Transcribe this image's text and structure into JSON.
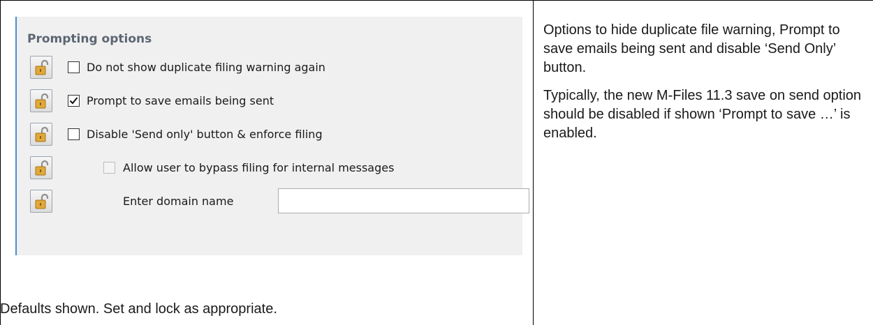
{
  "panel": {
    "title": "Prompting options",
    "rows": [
      {
        "label": "Do not show duplicate filing warning again",
        "checked": false,
        "enabled": true
      },
      {
        "label": "Prompt to save emails being sent",
        "checked": true,
        "enabled": true
      },
      {
        "label": "Disable 'Send only' button & enforce filing",
        "checked": false,
        "enabled": true
      },
      {
        "label": "Allow user to bypass filing for internal messages",
        "checked": false,
        "enabled": false
      },
      {
        "label": "Enter domain name",
        "value": ""
      }
    ]
  },
  "footer_note": "Defaults shown. Set and lock as appropriate.",
  "description": {
    "paragraph_1": "Options to hide duplicate file warning, Prompt to save emails being sent and disable ‘Send Only’ button.",
    "paragraph_2": "Typically, the new M-Files 11.3 save on send option should be disabled if shown ‘Prompt to save …’ is enabled."
  },
  "icons": {
    "lock": "padlock-unlocked-icon"
  },
  "colors": {
    "accent": "#4f8bd3",
    "panel_bg": "#f0f0f0",
    "lock_gold": "#d9a032"
  }
}
